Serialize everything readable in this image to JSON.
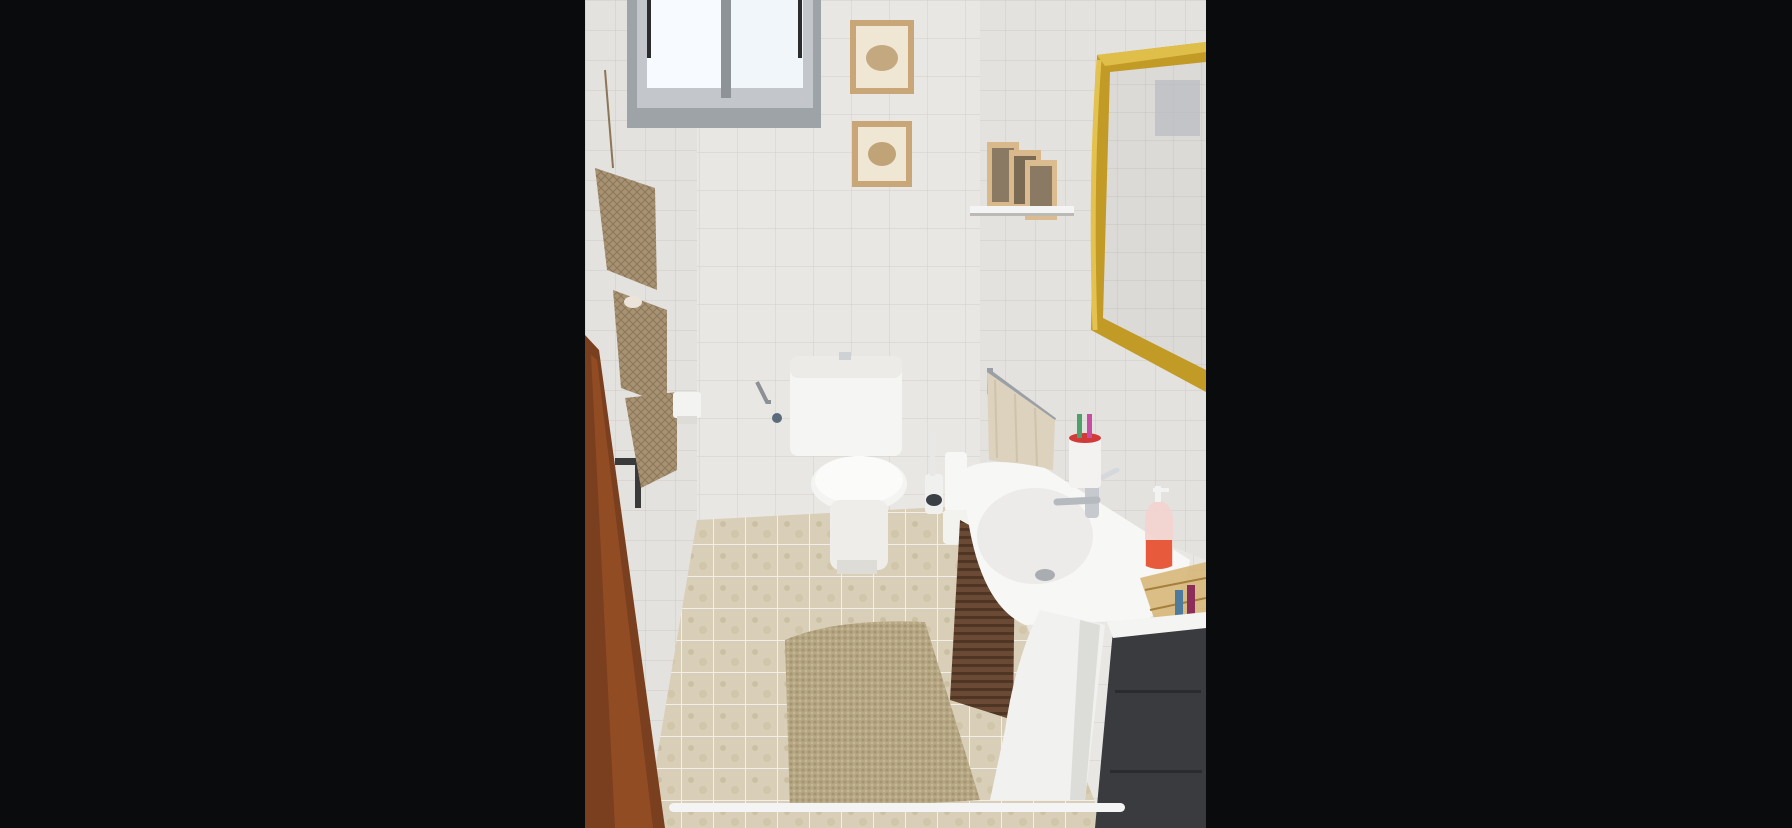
{
  "viewer": {
    "background_color": "#0a0b0c",
    "image_label": ""
  },
  "photo": {
    "subject_icons": [
      "window-icon",
      "framed-picture-icon",
      "crochet-basket-icon",
      "toilet-icon",
      "washbasin-icon",
      "mirror-icon",
      "door-icon",
      "bath-mat-icon"
    ],
    "palette": {
      "wall_tile": "#e8e6e2",
      "floor_tile": "#d8cdb6",
      "mirror_frame": "#c9a227",
      "door_wood": "#7a3f1e",
      "basket": "#a08a6e",
      "mat": "#b8a888"
    }
  },
  "home_indicator": {
    "color": "#f4f4f4"
  }
}
